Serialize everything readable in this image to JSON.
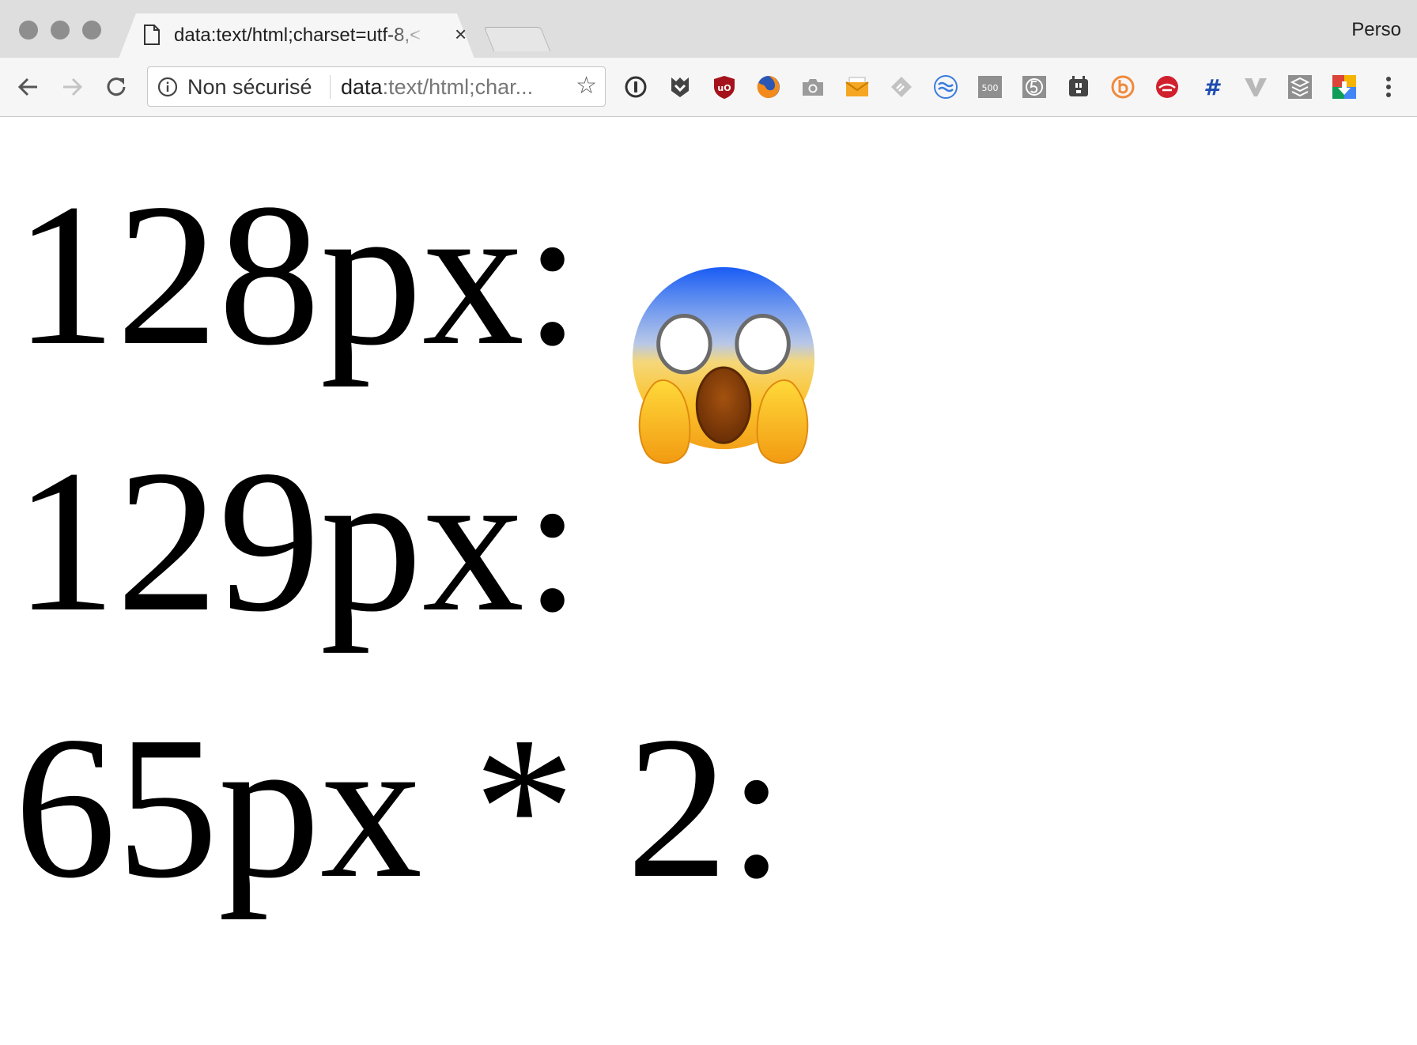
{
  "window": {
    "tab_title": "data:text/html;charset=utf-8,<",
    "close_glyph": "×",
    "profile_name": "Perso"
  },
  "toolbar": {
    "security_label": "Non sécurisé",
    "url_scheme": "data",
    "url_rest": ":text/html;char...",
    "bookmark_glyph": "☆",
    "extensions": [
      "1password-icon",
      "ghostery-icon",
      "ublock-origin-icon",
      "firefox-icon",
      "camera-icon",
      "mail-icon",
      "feedly-icon",
      "wave-icon",
      "500px-icon",
      "five-icon",
      "plug-icon",
      "b-icon",
      "speedtest-icon",
      "hashtag-icon",
      "vivaldi-v-icon",
      "layers-icon",
      "google-download-icon",
      "more-menu-icon"
    ],
    "extension_labels": {
      "ublock": "uO",
      "fivehundred": "500",
      "hashtag": "#"
    }
  },
  "page": {
    "lines": [
      "128px:",
      "129px:",
      "65px * 2:"
    ],
    "emoji": "face-screaming-in-fear"
  },
  "colors": {
    "tabstrip": "#dedede",
    "toolbar": "#f6f6f6",
    "page_bg": "#ffffff",
    "text": "#000000"
  }
}
